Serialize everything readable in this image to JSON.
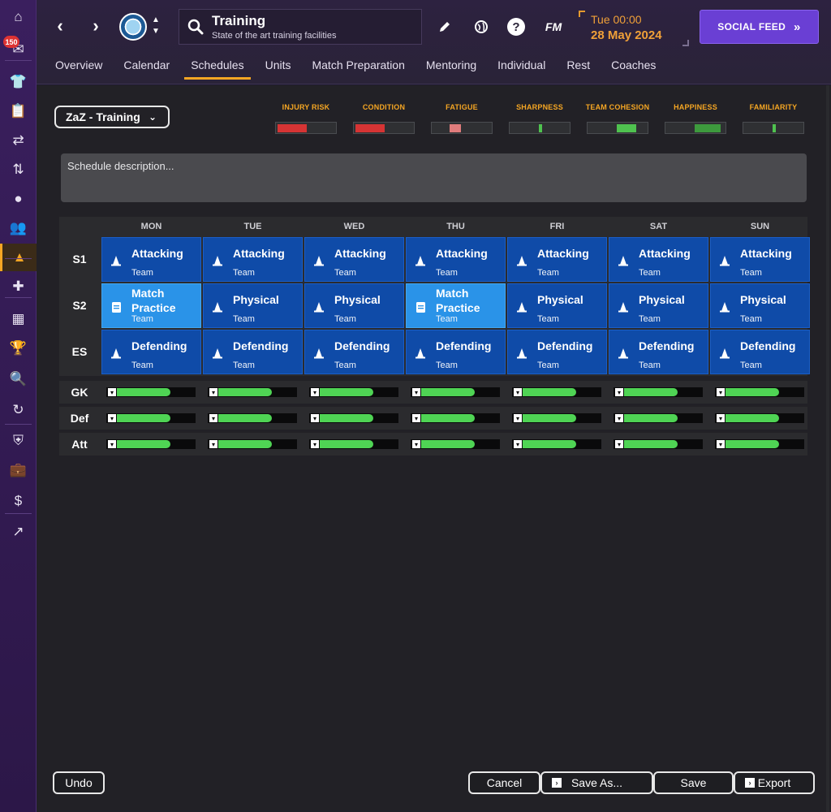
{
  "sidebar": {
    "badge_count": "150",
    "items": [
      {
        "name": "home-icon",
        "glyph": "⌂"
      },
      {
        "name": "inbox-icon",
        "glyph": "✉"
      },
      {
        "name": "squad-icon",
        "glyph": "👕"
      },
      {
        "name": "tactics-icon",
        "glyph": "📋"
      },
      {
        "name": "transfers-icon",
        "glyph": "⇄"
      },
      {
        "name": "dynamics-icon",
        "glyph": "⇅"
      },
      {
        "name": "ball-icon",
        "glyph": "●"
      },
      {
        "name": "staff-icon",
        "glyph": "👥"
      },
      {
        "name": "training-icon",
        "glyph": "▲"
      },
      {
        "name": "medical-icon",
        "glyph": "✚"
      },
      {
        "name": "schedule-icon",
        "glyph": "▦"
      },
      {
        "name": "competitions-icon",
        "glyph": "🏆"
      },
      {
        "name": "scouting-icon",
        "glyph": "🔍"
      },
      {
        "name": "refresh-icon",
        "glyph": "↻"
      },
      {
        "name": "club-icon",
        "glyph": "⛨"
      },
      {
        "name": "briefcase-icon",
        "glyph": "💼"
      },
      {
        "name": "finances-icon",
        "glyph": "$"
      },
      {
        "name": "development-icon",
        "glyph": "↗"
      }
    ]
  },
  "header": {
    "title": "Training",
    "subtitle": "State of the art training facilities",
    "time": "Tue 00:00",
    "date": "28 May 2024",
    "social_feed": "SOCIAL FEED",
    "fm_logo": "FM",
    "help": "?"
  },
  "tabs": [
    "Overview",
    "Calendar",
    "Schedules",
    "Units",
    "Match Preparation",
    "Mentoring",
    "Individual",
    "Rest",
    "Coaches"
  ],
  "active_tab": "Schedules",
  "schedule_name": "ZaZ - Training",
  "meters": [
    {
      "label": "INJURY RISK",
      "color": "#d63434",
      "level": 0.5
    },
    {
      "label": "CONDITION",
      "color": "#d63434",
      "level": 0.5
    },
    {
      "label": "FATIGUE",
      "color": "#e07c7c",
      "level": 0.2
    },
    {
      "label": "SHARPNESS",
      "color": "#4fc24f",
      "level": 0.05
    },
    {
      "label": "TEAM COHESION",
      "color": "#4fc24f",
      "level": 0.33
    },
    {
      "label": "HAPPINESS",
      "color": "#3d9a3d",
      "level": 0.45
    },
    {
      "label": "FAMILIARITY",
      "color": "#4fc24f",
      "level": 0.05
    }
  ],
  "description_placeholder": "Schedule description...",
  "days": [
    "MON",
    "TUE",
    "WED",
    "THU",
    "FRI",
    "SAT",
    "SUN"
  ],
  "sessions": [
    {
      "label": "S1",
      "cells": [
        {
          "title": "Attacking",
          "sub": "Team",
          "type": "normal"
        },
        {
          "title": "Attacking",
          "sub": "Team",
          "type": "normal"
        },
        {
          "title": "Attacking",
          "sub": "Team",
          "type": "normal"
        },
        {
          "title": "Attacking",
          "sub": "Team",
          "type": "normal"
        },
        {
          "title": "Attacking",
          "sub": "Team",
          "type": "normal"
        },
        {
          "title": "Attacking",
          "sub": "Team",
          "type": "normal"
        },
        {
          "title": "Attacking",
          "sub": "Team",
          "type": "normal"
        }
      ]
    },
    {
      "label": "S2",
      "cells": [
        {
          "title": "Match Practice",
          "sub": "Team",
          "type": "match"
        },
        {
          "title": "Physical",
          "sub": "Team",
          "type": "normal"
        },
        {
          "title": "Physical",
          "sub": "Team",
          "type": "normal"
        },
        {
          "title": "Match Practice",
          "sub": "Team",
          "type": "match"
        },
        {
          "title": "Physical",
          "sub": "Team",
          "type": "normal"
        },
        {
          "title": "Physical",
          "sub": "Team",
          "type": "normal"
        },
        {
          "title": "Physical",
          "sub": "Team",
          "type": "normal"
        }
      ]
    },
    {
      "label": "ES",
      "cells": [
        {
          "title": "Defending",
          "sub": "Team",
          "type": "normal"
        },
        {
          "title": "Defending",
          "sub": "Team",
          "type": "normal"
        },
        {
          "title": "Defending",
          "sub": "Team",
          "type": "normal"
        },
        {
          "title": "Defending",
          "sub": "Team",
          "type": "normal"
        },
        {
          "title": "Defending",
          "sub": "Team",
          "type": "normal"
        },
        {
          "title": "Defending",
          "sub": "Team",
          "type": "normal"
        },
        {
          "title": "Defending",
          "sub": "Team",
          "type": "normal"
        }
      ]
    }
  ],
  "load_rows": [
    {
      "label": "GK",
      "levels": [
        0.69,
        0.69,
        0.69,
        0.69,
        0.69,
        0.69,
        0.69
      ]
    },
    {
      "label": "Def",
      "levels": [
        0.69,
        0.69,
        0.69,
        0.69,
        0.69,
        0.69,
        0.69
      ]
    },
    {
      "label": "Att",
      "levels": [
        0.69,
        0.69,
        0.69,
        0.69,
        0.69,
        0.69,
        0.69
      ]
    }
  ],
  "buttons": {
    "undo": "Undo",
    "cancel": "Cancel",
    "save_as": "Save As...",
    "save": "Save",
    "export": "Export"
  }
}
